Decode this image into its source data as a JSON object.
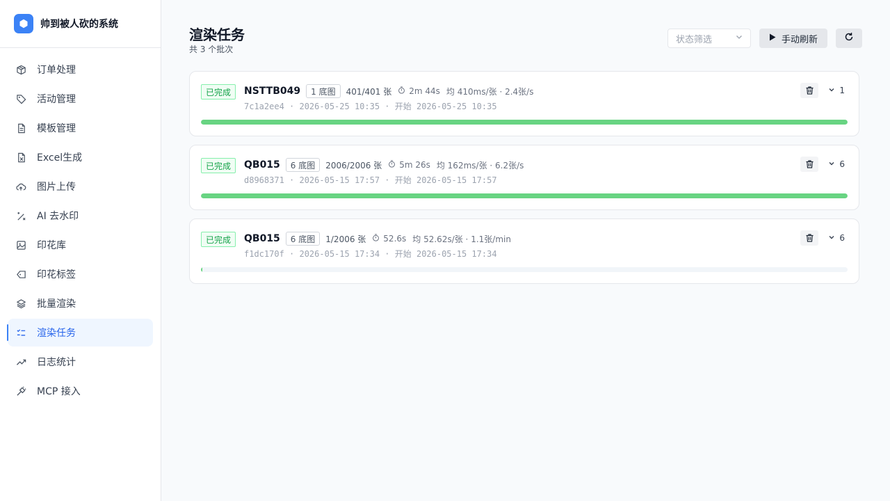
{
  "brand": {
    "name": "帅到被人砍的系统"
  },
  "nav": [
    {
      "label": "订单处理",
      "icon": "package-icon",
      "active": false
    },
    {
      "label": "活动管理",
      "icon": "tag-icon",
      "active": false
    },
    {
      "label": "模板管理",
      "icon": "file-icon",
      "active": false
    },
    {
      "label": "Excel生成",
      "icon": "spreadsheet-icon",
      "active": false
    },
    {
      "label": "图片上传",
      "icon": "cloud-upload-icon",
      "active": false
    },
    {
      "label": "AI 去水印",
      "icon": "magic-wand-icon",
      "active": false
    },
    {
      "label": "印花库",
      "icon": "image-icon",
      "active": false
    },
    {
      "label": "印花标签",
      "icon": "label-icon",
      "active": false
    },
    {
      "label": "批量渲染",
      "icon": "layers-icon",
      "active": false
    },
    {
      "label": "渲染任务",
      "icon": "task-list-icon",
      "active": true
    },
    {
      "label": "日志统计",
      "icon": "trend-icon",
      "active": false
    },
    {
      "label": "MCP 接入",
      "icon": "plug-icon",
      "active": false
    }
  ],
  "page": {
    "title": "渲染任务",
    "subtitle": "共 3 个批次"
  },
  "toolbar": {
    "filter_placeholder": "状态筛选",
    "refresh_label": "手动刷新"
  },
  "colors": {
    "accent": "#3b82f6",
    "success": "#16a34a",
    "progress": "#68d482"
  },
  "batches": [
    {
      "status": "已完成",
      "code": "NSTTB049",
      "base_tag": "1 底图",
      "count": "401/401 张",
      "duration": "2m 44s",
      "avg": "均 410ms/张 · 2.4张/s",
      "meta": "7c1a2ee4 · 2026-05-25 10:35 · 开始 2026-05-25 10:35",
      "expand_count": "1",
      "progress": 1.0
    },
    {
      "status": "已完成",
      "code": "QB015",
      "base_tag": "6 底图",
      "count": "2006/2006 张",
      "duration": "5m 26s",
      "avg": "均 162ms/张 · 6.2张/s",
      "meta": "d8968371 · 2026-05-15 17:57 · 开始 2026-05-15 17:57",
      "expand_count": "6",
      "progress": 1.0
    },
    {
      "status": "已完成",
      "code": "QB015",
      "base_tag": "6 底图",
      "count": "1/2006 张",
      "duration": "52.6s",
      "avg": "均 52.62s/张 · 1.1张/min",
      "meta": "f1dc170f · 2026-05-15 17:34 · 开始 2026-05-15 17:34",
      "expand_count": "6",
      "progress": 0.0005
    }
  ]
}
